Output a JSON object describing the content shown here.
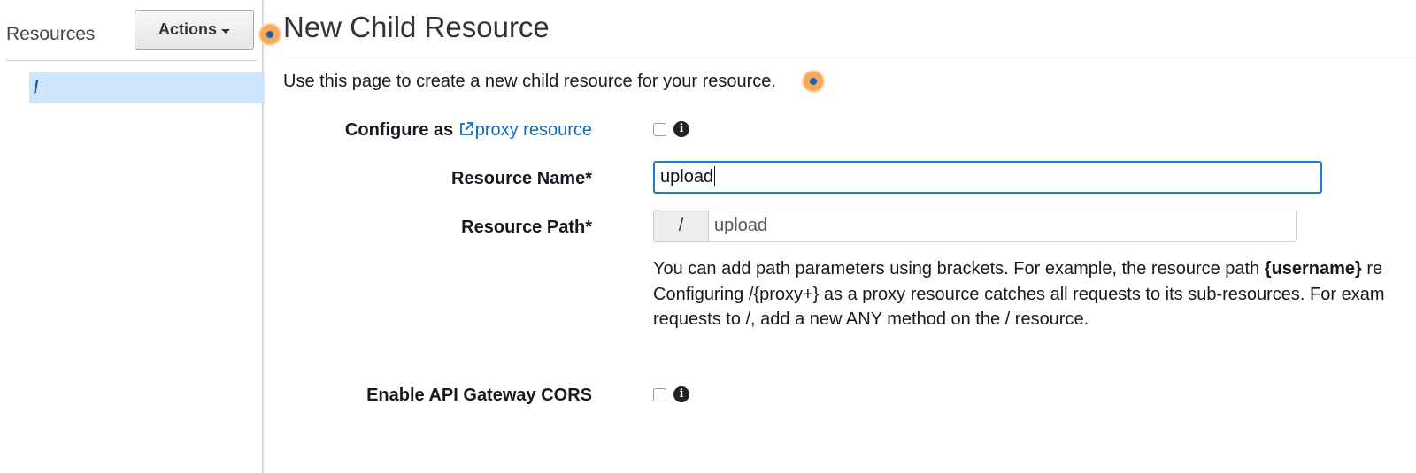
{
  "sidebar": {
    "title": "Resources",
    "actions_label": "Actions",
    "tree": [
      {
        "label": "/"
      }
    ]
  },
  "main": {
    "title": "New Child Resource",
    "intro": "Use this page to create a new child resource for your resource.",
    "proxy": {
      "label_prefix": "Configure as",
      "link_text": "proxy resource",
      "checked": false
    },
    "resource_name": {
      "label": "Resource Name*",
      "value": "upload"
    },
    "resource_path": {
      "label": "Resource Path*",
      "prefix": "/",
      "value": "upload"
    },
    "help": {
      "line1_start": "You can add path parameters using brackets. For example, the resource path ",
      "line1_bold": "{username}",
      "line1_end": " re",
      "line2": "Configuring /{proxy+} as a proxy resource catches all requests to its sub-resources. For exam",
      "line3": "requests to /, add a new ANY method on the / resource."
    },
    "cors": {
      "label": "Enable API Gateway CORS",
      "checked": false
    }
  },
  "colors": {
    "link": "#0f6bbf",
    "selected_bg": "#cfe5fb",
    "input_focus": "#1a7ad4",
    "hotspot": "#f7a95a"
  }
}
